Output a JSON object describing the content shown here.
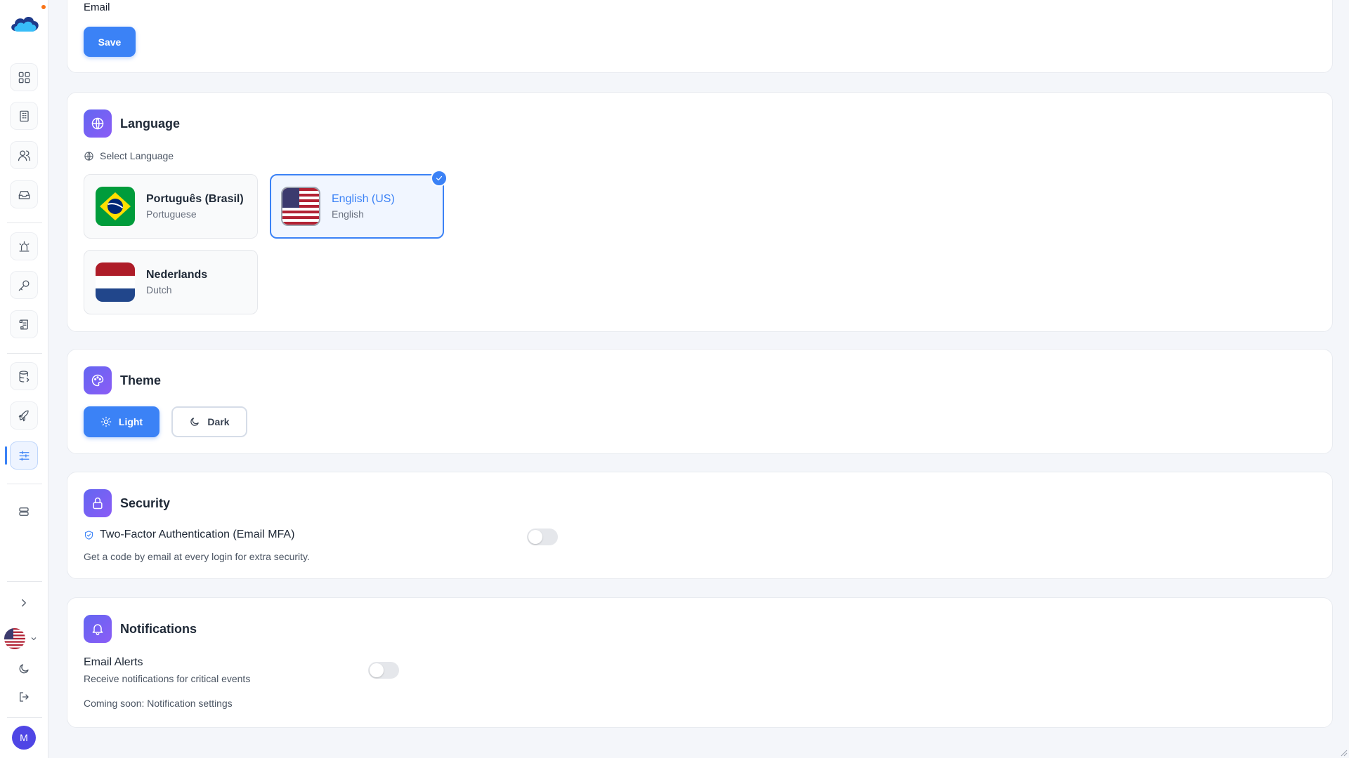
{
  "email_section": {
    "label": "Email",
    "save_label": "Save"
  },
  "language": {
    "title": "Language",
    "select_label": "Select Language",
    "options": [
      {
        "name": "Português (Brasil)",
        "sub": "Portuguese",
        "flag": "brazil-flag",
        "selected": false
      },
      {
        "name": "English (US)",
        "sub": "English",
        "flag": "us-flag",
        "selected": true
      },
      {
        "name": "Nederlands",
        "sub": "Dutch",
        "flag": "netherlands-flag",
        "selected": false
      }
    ]
  },
  "theme": {
    "title": "Theme",
    "light_label": "Light",
    "dark_label": "Dark",
    "selected": "Light"
  },
  "security": {
    "title": "Security",
    "mfa_label": "Two-Factor Authentication (Email MFA)",
    "mfa_desc": "Get a code by email at every login for extra security.",
    "mfa_enabled": false
  },
  "notifications": {
    "title": "Notifications",
    "email_alerts_label": "Email Alerts",
    "email_alerts_desc": "Receive notifications for critical events",
    "email_alerts_enabled": false,
    "coming_soon": "Coming soon: Notification settings"
  },
  "sidebar": {
    "icons": [
      "dashboard-icon",
      "building-icon",
      "users-icon",
      "inbox-icon",
      "alarm-icon",
      "key-icon",
      "scroll-icon",
      "database-icon",
      "rocket-icon",
      "settings-sliders-icon",
      "server-icon"
    ],
    "active": "settings-sliders-icon",
    "avatar_initial": "M"
  },
  "colors": {
    "accent": "#3b82f6",
    "section_icon": "#6366f1",
    "background": "#f4f6fa"
  }
}
